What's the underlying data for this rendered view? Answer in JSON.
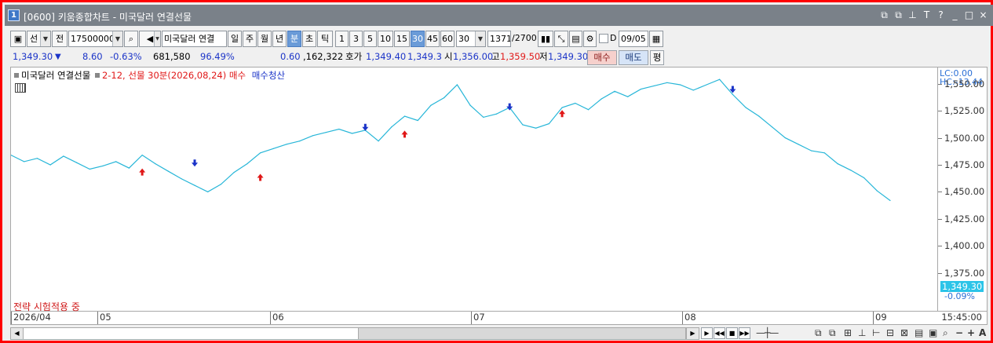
{
  "window": {
    "number": "1",
    "title": "[0600] 키움종합차트 - 미국달러 연결선물",
    "controls": [
      "⧉",
      "⧉",
      "⊥",
      "T",
      "?",
      "_",
      "□",
      "×"
    ]
  },
  "toolbar": {
    "layout_icon": "layout-icon",
    "type_label": "선",
    "prev_label": "전",
    "code_value": "17500000",
    "search_icon": "search-icon",
    "speaker_icon": "speaker-icon",
    "symbol_name": "미국달러 연결",
    "period_buttons": [
      "일",
      "주",
      "월",
      "년",
      "분",
      "초",
      "틱"
    ],
    "period_selected": "분",
    "interval_buttons": [
      "1",
      "3",
      "5",
      "10",
      "15",
      "30",
      "45",
      "60"
    ],
    "interval_selected": "30",
    "interval_value": "30",
    "count_value": "1371",
    "count_total": "/2700",
    "date_checkbox_label": "D",
    "date_value": "09/05"
  },
  "quote": {
    "price": "1,349.30",
    "change_arrow": "▼",
    "change": "8.60",
    "change_pct": "-0.63%",
    "volume": "681,580",
    "volume_pct": "96.49%",
    "val1": "0.60",
    "val2": ",162,322",
    "hoga_label": "호가",
    "hoga1": "1,349.40",
    "hoga2": "1,349.3",
    "open_label": "시",
    "open": "1,356.00",
    "high_label": "고",
    "high": "1,359.50",
    "low_label": "저",
    "low": "1,349.30",
    "buy_button": "매수",
    "sell_button": "매도",
    "eval_button": "평"
  },
  "legend": {
    "series_name": "미국달러 연결선물",
    "strategy_text": "2-12, 선물 30분(2026,08,24)",
    "buy_label": "매수",
    "sell_label": "매수청산"
  },
  "right_axis": {
    "lc": "LC:0.00",
    "hc": "HC:-13.44",
    "last_price": "1,349.30",
    "last_pct": "-0.09%"
  },
  "strategy_note": "전략 시험적용 중",
  "x_axis": {
    "labels": [
      "2026/04",
      "05",
      "06",
      "07",
      "08",
      "09"
    ],
    "time": "15:45:00"
  },
  "chart_data": {
    "type": "line",
    "title": "",
    "series": [
      {
        "name": "미국달러 연결선물",
        "color": "#27b6d8",
        "x": [
          "04/01",
          "04/03",
          "04/06",
          "04/08",
          "04/10",
          "04/13",
          "04/15",
          "04/17",
          "04/20",
          "04/22",
          "04/24",
          "04/27",
          "04/29",
          "05/01",
          "05/04",
          "05/06",
          "05/08",
          "05/11",
          "05/13",
          "05/15",
          "05/18",
          "05/20",
          "05/22",
          "05/25",
          "05/27",
          "05/29",
          "06/01",
          "06/03",
          "06/05",
          "06/08",
          "06/10",
          "06/12",
          "06/15",
          "06/17",
          "06/19",
          "06/22",
          "06/24",
          "06/26",
          "06/29",
          "07/01",
          "07/03",
          "07/06",
          "07/08",
          "07/10",
          "07/13",
          "07/15",
          "07/17",
          "07/20",
          "07/22",
          "07/24",
          "07/27",
          "07/29",
          "07/31",
          "08/03",
          "08/05",
          "08/07",
          "08/10",
          "08/12",
          "08/14",
          "08/17",
          "08/19",
          "08/21",
          "08/24",
          "08/26",
          "08/28",
          "08/31",
          "09/02",
          "09/04"
        ],
        "y": [
          1484,
          1478,
          1481,
          1475,
          1483,
          1477,
          1471,
          1474,
          1478,
          1472,
          1484,
          1476,
          1469,
          1462,
          1456,
          1450,
          1457,
          1468,
          1476,
          1486,
          1490,
          1494,
          1497,
          1502,
          1505,
          1508,
          1504,
          1507,
          1497,
          1510,
          1520,
          1516,
          1530,
          1537,
          1549,
          1530,
          1519,
          1522,
          1528,
          1512,
          1509,
          1513,
          1528,
          1532,
          1526,
          1536,
          1543,
          1538,
          1545,
          1548,
          1551,
          1549,
          1544,
          1549,
          1554,
          1540,
          1528,
          1520,
          1510,
          1500,
          1494,
          1488,
          1486,
          1476,
          1470,
          1463,
          1451,
          1442
        ]
      }
    ],
    "ylim": [
      1340,
      1565
    ],
    "yticks": [
      "1,550.00",
      "1,525.00",
      "1,500.00",
      "1,475.00",
      "1,450.00",
      "1,425.00",
      "1,400.00",
      "1,375.00"
    ],
    "signals": [
      {
        "type": "buy",
        "color": "#e01818",
        "x_index": 10,
        "y": 1468
      },
      {
        "type": "sell",
        "color": "#1b34c8",
        "x_index": 14,
        "y": 1477
      },
      {
        "type": "buy",
        "color": "#e01818",
        "x_index": 19,
        "y": 1463
      },
      {
        "type": "sell",
        "color": "#1b34c8",
        "x_index": 27,
        "y": 1510
      },
      {
        "type": "buy",
        "color": "#e01818",
        "x_index": 30,
        "y": 1503
      },
      {
        "type": "sell",
        "color": "#1b34c8",
        "x_index": 38,
        "y": 1529
      },
      {
        "type": "buy",
        "color": "#e01818",
        "x_index": 42,
        "y": 1522
      },
      {
        "type": "sell",
        "color": "#1b34c8",
        "x_index": 55,
        "y": 1545
      }
    ],
    "grid": false,
    "legend": "top-left"
  }
}
